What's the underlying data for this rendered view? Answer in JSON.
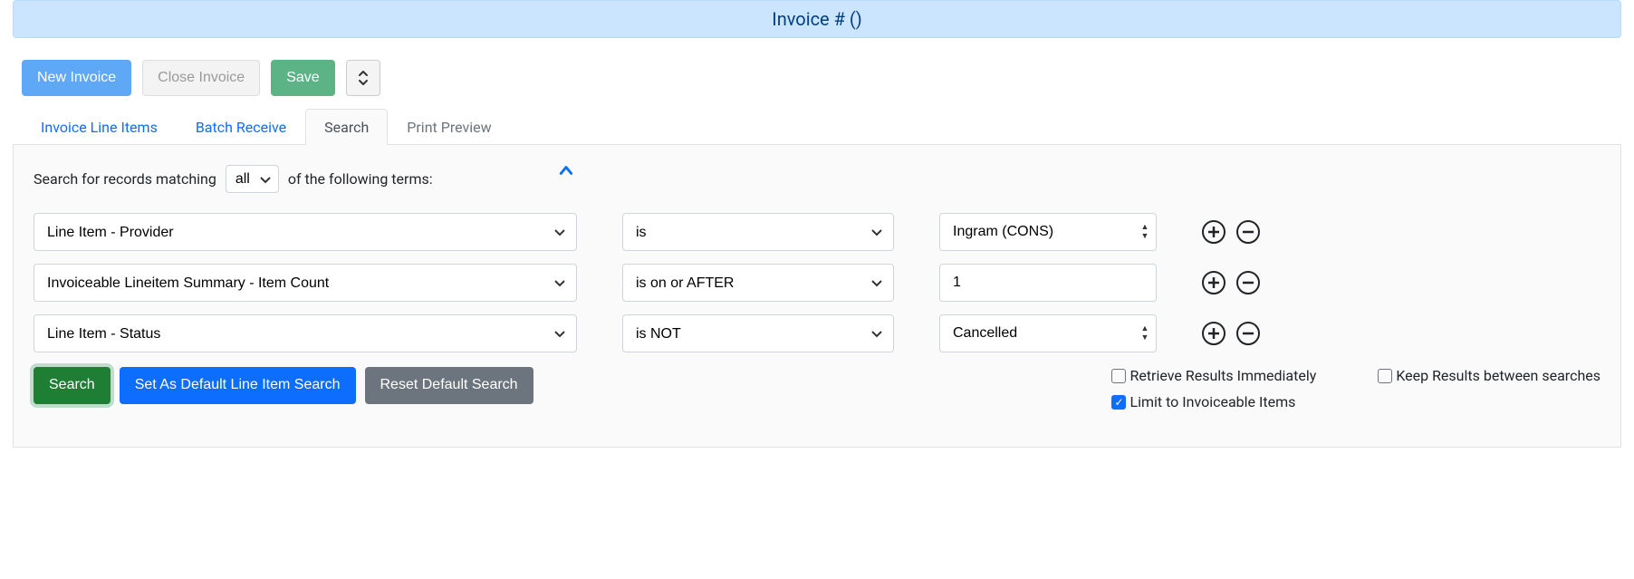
{
  "header": {
    "title": "Invoice # ()"
  },
  "toolbar": {
    "new_invoice": "New Invoice",
    "close_invoice": "Close Invoice",
    "save": "Save"
  },
  "tabs": {
    "line_items": "Invoice Line Items",
    "batch_receive": "Batch Receive",
    "search": "Search",
    "print_preview": "Print Preview"
  },
  "search": {
    "prefix": "Search for records matching",
    "match_mode": "all",
    "suffix": "of the following terms:",
    "rows": [
      {
        "field": "Line Item - Provider",
        "op": "is",
        "value": "Ingram (CONS)",
        "value_type": "select"
      },
      {
        "field": "Invoiceable Lineitem Summary - Item Count",
        "op": "is on or AFTER",
        "value": "1",
        "value_type": "number"
      },
      {
        "field": "Line Item - Status",
        "op": "is NOT",
        "value": "Cancelled",
        "value_type": "select"
      }
    ],
    "buttons": {
      "search": "Search",
      "set_default": "Set As Default Line Item Search",
      "reset_default": "Reset Default Search"
    },
    "checks": {
      "retrieve_immediately": {
        "label": "Retrieve Results Immediately",
        "checked": false
      },
      "keep_results": {
        "label": "Keep Results between searches",
        "checked": false
      },
      "limit_invoiceable": {
        "label": "Limit to Invoiceable Items",
        "checked": true
      }
    }
  }
}
